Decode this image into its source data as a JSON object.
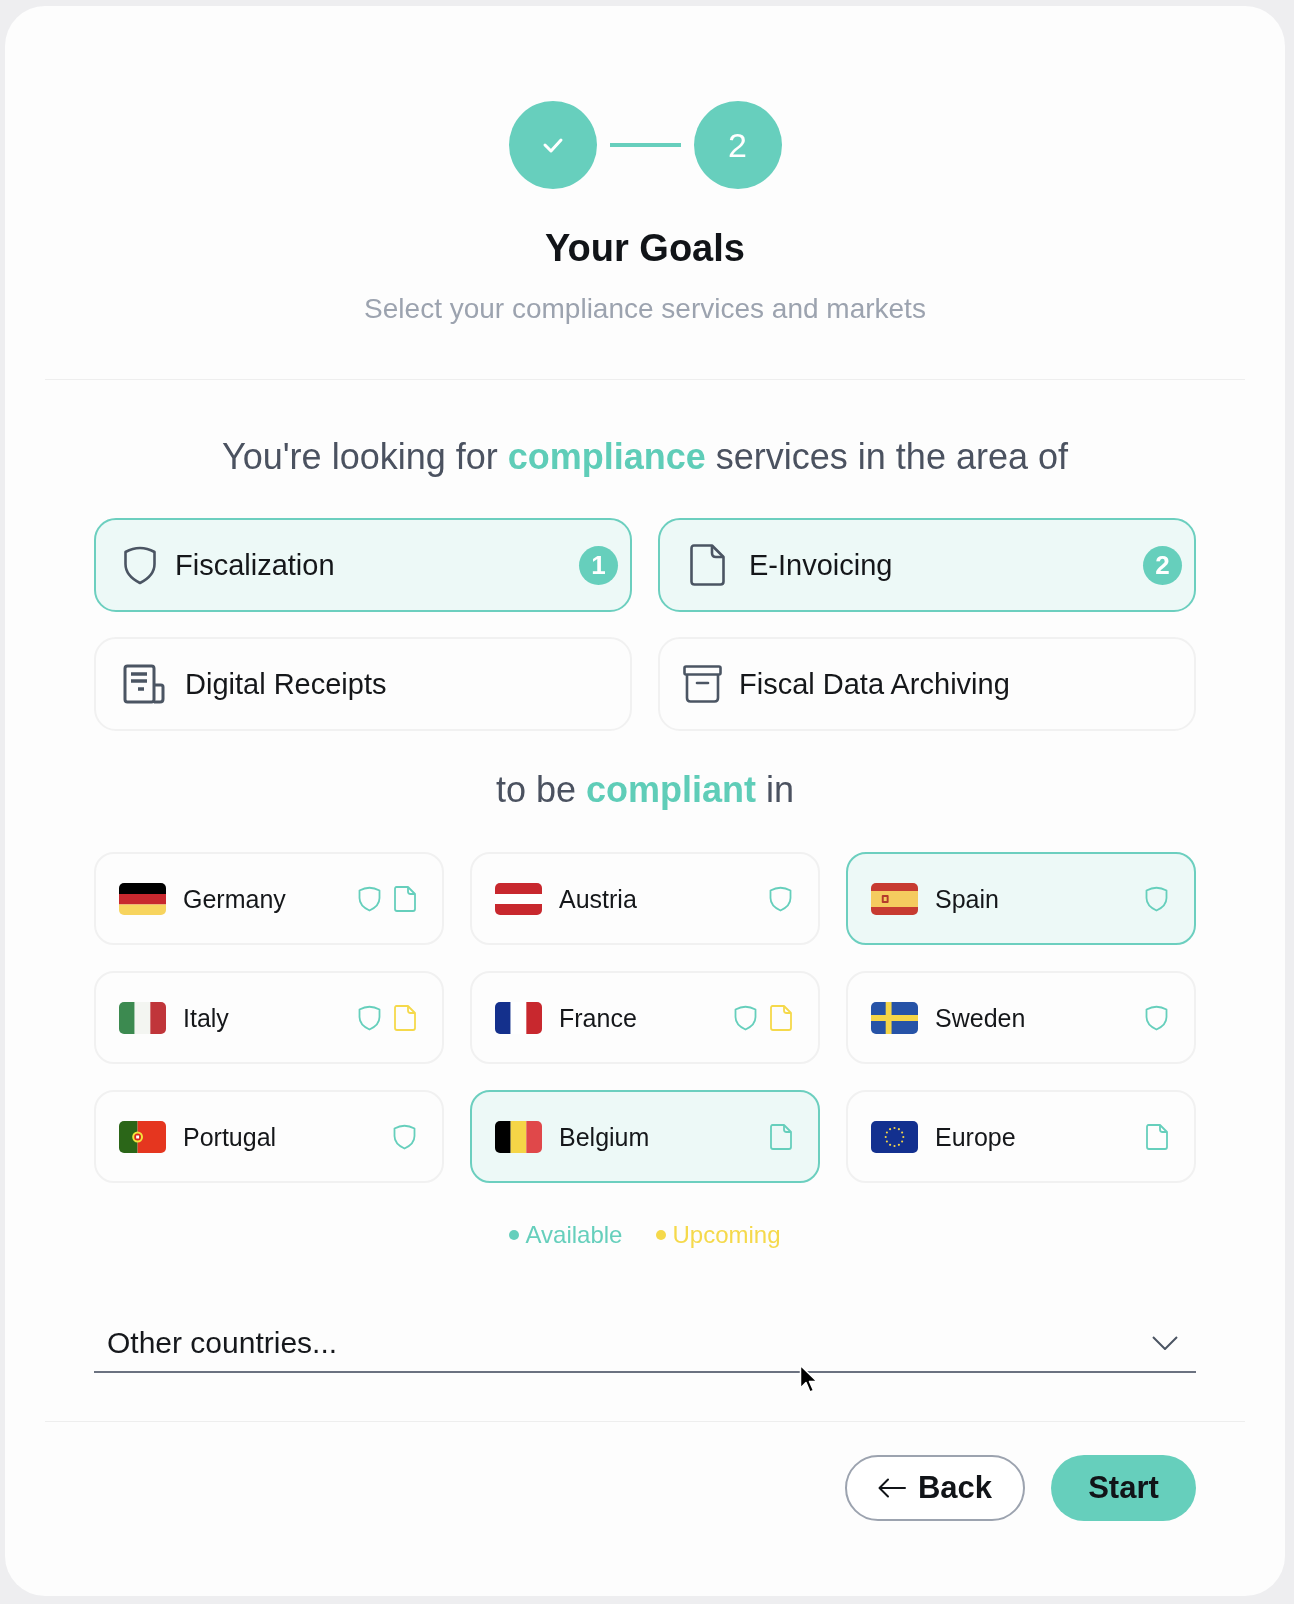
{
  "stepper": {
    "steps": [
      {
        "completed": true
      },
      {
        "completed": false,
        "number": "2"
      }
    ]
  },
  "header": {
    "title": "Your Goals",
    "subtitle": "Select your compliance services and markets"
  },
  "services_heading": "You're looking for **compliance** services in the area of",
  "services": [
    {
      "label": "Fiscalization",
      "kind": "fiscalization",
      "selected": true,
      "badge": "1"
    },
    {
      "label": "E-Invoicing",
      "kind": "invoicing",
      "selected": true,
      "badge": "2"
    },
    {
      "label": "Digital Receipts",
      "kind": "receipts",
      "selected": false
    },
    {
      "label": "Fiscal Data Archiving",
      "kind": "archiving",
      "selected": false
    }
  ],
  "countries_heading": "to be **compliant** in",
  "countries": [
    {
      "name": "Germany",
      "kind": "de",
      "selected": false,
      "services": [
        {
          "kind": "fiscalization",
          "color": "#66cfbc"
        },
        {
          "kind": "invoicing",
          "color": "#66cfbc"
        }
      ]
    },
    {
      "name": "Austria",
      "kind": "at",
      "selected": false,
      "services": [
        {
          "kind": "fiscalization",
          "color": "#66cfbc"
        }
      ]
    },
    {
      "name": "Spain",
      "kind": "es",
      "selected": true,
      "services": [
        {
          "kind": "fiscalization",
          "color": "#66cfbc"
        }
      ]
    },
    {
      "name": "Italy",
      "kind": "it",
      "selected": false,
      "services": [
        {
          "kind": "fiscalization",
          "color": "#66cfbc"
        },
        {
          "kind": "invoicing",
          "color": "#f5d94b"
        }
      ]
    },
    {
      "name": "France",
      "kind": "fr",
      "selected": false,
      "services": [
        {
          "kind": "fiscalization",
          "color": "#66cfbc"
        },
        {
          "kind": "invoicing",
          "color": "#f5d94b"
        }
      ]
    },
    {
      "name": "Sweden",
      "kind": "se",
      "selected": false,
      "services": [
        {
          "kind": "fiscalization",
          "color": "#66cfbc"
        }
      ]
    },
    {
      "name": "Portugal",
      "kind": "pt",
      "selected": false,
      "services": [
        {
          "kind": "fiscalization",
          "color": "#66cfbc"
        }
      ]
    },
    {
      "name": "Belgium",
      "kind": "be",
      "selected": true,
      "services": [
        {
          "kind": "invoicing",
          "color": "#66cfbc"
        }
      ]
    },
    {
      "name": "Europe",
      "kind": "eu",
      "selected": false,
      "services": [
        {
          "kind": "invoicing",
          "color": "#66cfbc"
        }
      ]
    }
  ],
  "legend": [
    {
      "label": "Available",
      "color": "#66cfbc"
    },
    {
      "label": "Upcoming",
      "color": "#f5d94b"
    }
  ],
  "other_countries": {
    "placeholder": "Other countries..."
  },
  "buttons": [
    {
      "label": "Back",
      "kind": "back"
    },
    {
      "label": "Start",
      "kind": "primary"
    }
  ]
}
